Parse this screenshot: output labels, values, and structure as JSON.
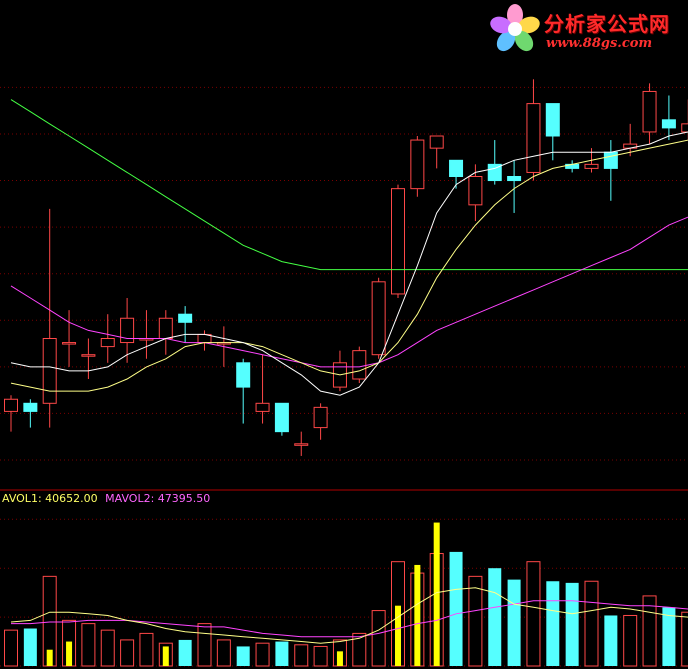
{
  "logo": {
    "title": "分析家公式网",
    "url": "www.88gs.com"
  },
  "volume_legend": [
    {
      "label": "AVOL1: 40652.00",
      "color": "#ffff66"
    },
    {
      "label": "MAVOL2: 47395.50",
      "color": "#ff66ff"
    }
  ],
  "colors": {
    "background": "#000000",
    "up": "#ff4848",
    "down": "#55ffff",
    "volume_up_bright": "#ffff00",
    "ma_short": "#ffffff",
    "ma_mid": "#ffff88",
    "ma_long": "#ff44ff",
    "ma_longest": "#44ff44",
    "grid": "#7a0000",
    "divider": "#b00000"
  },
  "chart_data": [
    {
      "type": "candlestick",
      "price_range": [
        0,
        100
      ],
      "grid": true,
      "candles": [
        {
          "o": 12,
          "c": 15,
          "h": 16,
          "l": 7
        },
        {
          "o": 14,
          "c": 12,
          "h": 15,
          "l": 8
        },
        {
          "o": 14,
          "c": 30,
          "h": 62,
          "l": 8
        },
        {
          "o": 29,
          "c": 29,
          "h": 37,
          "l": 23
        },
        {
          "o": 26,
          "c": 26,
          "h": 30,
          "l": 20
        },
        {
          "o": 28,
          "c": 30,
          "h": 36,
          "l": 24
        },
        {
          "o": 29,
          "c": 35,
          "h": 40,
          "l": 24
        },
        {
          "o": 30,
          "c": 30,
          "h": 37,
          "l": 25
        },
        {
          "o": 30,
          "c": 35,
          "h": 37,
          "l": 26
        },
        {
          "o": 36,
          "c": 34,
          "h": 38,
          "l": 29
        },
        {
          "o": 29,
          "c": 31,
          "h": 32,
          "l": 27
        },
        {
          "o": 29,
          "c": 29,
          "h": 33,
          "l": 23
        },
        {
          "o": 24,
          "c": 18,
          "h": 25,
          "l": 9
        },
        {
          "o": 12,
          "c": 14,
          "h": 26,
          "l": 9
        },
        {
          "o": 14,
          "c": 7,
          "h": 14,
          "l": 6
        },
        {
          "o": 4,
          "c": 4,
          "h": 7,
          "l": 1
        },
        {
          "o": 8,
          "c": 13,
          "h": 14,
          "l": 5
        },
        {
          "o": 18,
          "c": 24,
          "h": 27,
          "l": 17
        },
        {
          "o": 20,
          "c": 27,
          "h": 28,
          "l": 19
        },
        {
          "o": 26,
          "c": 44,
          "h": 45,
          "l": 25
        },
        {
          "o": 41,
          "c": 67,
          "h": 68,
          "l": 40
        },
        {
          "o": 67,
          "c": 79,
          "h": 80,
          "l": 65
        },
        {
          "o": 77,
          "c": 80,
          "h": 80,
          "l": 72
        },
        {
          "o": 74,
          "c": 70,
          "h": 74,
          "l": 67
        },
        {
          "o": 63,
          "c": 70,
          "h": 73,
          "l": 59
        },
        {
          "o": 73,
          "c": 69,
          "h": 79,
          "l": 68
        },
        {
          "o": 70,
          "c": 69,
          "h": 74,
          "l": 61
        },
        {
          "o": 71,
          "c": 88,
          "h": 94,
          "l": 69
        },
        {
          "o": 88,
          "c": 80,
          "h": 88,
          "l": 74
        },
        {
          "o": 73,
          "c": 72,
          "h": 74,
          "l": 71
        },
        {
          "o": 72,
          "c": 73,
          "h": 77,
          "l": 71
        },
        {
          "o": 76,
          "c": 72,
          "h": 79,
          "l": 64
        },
        {
          "o": 77,
          "c": 78,
          "h": 83,
          "l": 75
        },
        {
          "o": 81,
          "c": 91,
          "h": 93,
          "l": 78
        },
        {
          "o": 84,
          "c": 82,
          "h": 90,
          "l": 79
        },
        {
          "o": 81,
          "c": 83,
          "h": 89,
          "l": 79
        }
      ],
      "ma_short": [
        24,
        23,
        23,
        22,
        22,
        23,
        26,
        28,
        30,
        31,
        31,
        30,
        29,
        27,
        24,
        21,
        17,
        16,
        18,
        24,
        36,
        48,
        61,
        68,
        71,
        72,
        74,
        75,
        76,
        76,
        76,
        76,
        77,
        78,
        80,
        81
      ],
      "ma_mid": [
        19,
        18,
        17,
        17,
        17,
        18,
        20,
        23,
        25,
        28,
        29,
        29,
        29,
        28,
        26,
        24,
        22,
        21,
        22,
        24,
        29,
        36,
        45,
        52,
        58,
        63,
        67,
        70,
        72,
        73,
        74,
        75,
        76,
        77,
        78,
        79
      ],
      "ma_long": [
        43,
        40,
        37,
        34,
        32,
        31,
        30,
        30,
        30,
        29,
        29,
        28,
        27,
        26,
        25,
        24,
        23,
        23,
        23,
        24,
        26,
        29,
        32,
        34,
        36,
        38,
        40,
        42,
        44,
        46,
        48,
        50,
        52,
        55,
        58,
        60
      ],
      "ma_longest": [
        89,
        86,
        83,
        80,
        77,
        74,
        71,
        68,
        65,
        62,
        59,
        56,
        53,
        51,
        49,
        48,
        47,
        47,
        47,
        47,
        47,
        47,
        47,
        47,
        47,
        47,
        47,
        47,
        47,
        47,
        47,
        47,
        47,
        47,
        47,
        47
      ]
    },
    {
      "type": "bar",
      "series_desc": "volume",
      "volume_range": [
        0,
        100
      ],
      "volumes": [
        22,
        23,
        55,
        28,
        26,
        22,
        16,
        20,
        14,
        16,
        26,
        16,
        12,
        14,
        15,
        13,
        12,
        16,
        20,
        34,
        64,
        57,
        69,
        70,
        55,
        60,
        53,
        64,
        52,
        51,
        52,
        31,
        31,
        43,
        36,
        33
      ],
      "bright_secondary": [
        null,
        null,
        10,
        15,
        null,
        null,
        null,
        null,
        12,
        null,
        null,
        null,
        null,
        null,
        null,
        null,
        null,
        9,
        null,
        null,
        37,
        62,
        88,
        null,
        null,
        null,
        null,
        null,
        null,
        null,
        null,
        null,
        null,
        null,
        null,
        null
      ],
      "mavol1": [
        27,
        28,
        33,
        33,
        32,
        31,
        28,
        26,
        23,
        21,
        20,
        19,
        18,
        17,
        16,
        15,
        14,
        15,
        17,
        22,
        30,
        38,
        45,
        47,
        48,
        45,
        38,
        36,
        34,
        32,
        34,
        36,
        35,
        33,
        31,
        30
      ],
      "mavol2": [
        26,
        26,
        27,
        27,
        28,
        28,
        28,
        27,
        26,
        25,
        24,
        24,
        22,
        20,
        19,
        18,
        18,
        18,
        18,
        20,
        23,
        26,
        28,
        32,
        34,
        36,
        38,
        40,
        40,
        40,
        39,
        38,
        37,
        37,
        36,
        35
      ]
    }
  ]
}
